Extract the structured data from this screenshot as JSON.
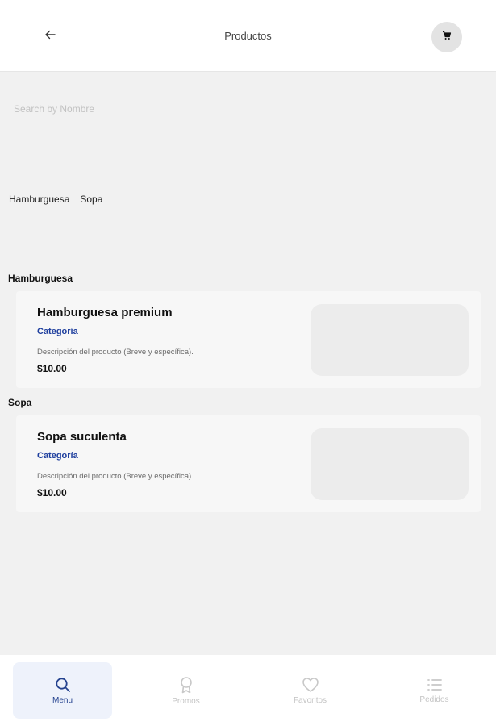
{
  "header": {
    "title": "Productos",
    "back_icon": "arrow-left-icon",
    "cart_icon": "cart-icon"
  },
  "search": {
    "placeholder": "Search by Nombre",
    "value": ""
  },
  "category_chips": [
    "Hamburguesa",
    "Sopa"
  ],
  "sections": [
    {
      "title": "Hamburguesa",
      "product": {
        "name": "Hamburguesa premium",
        "category": "Categoría",
        "description": "Descripción del producto (Breve y específica).",
        "price": "$10.00"
      }
    },
    {
      "title": "Sopa",
      "product": {
        "name": "Sopa suculenta",
        "category": "Categoría",
        "description": "Descripción del producto (Breve y específica).",
        "price": "$10.00"
      }
    }
  ],
  "bottom_nav": [
    {
      "label": "Menu",
      "icon": "search-icon",
      "active": true
    },
    {
      "label": "Promos",
      "icon": "award-icon",
      "active": false
    },
    {
      "label": "Favoritos",
      "icon": "heart-icon",
      "active": false
    },
    {
      "label": "Pedidos",
      "icon": "list-icon",
      "active": false
    }
  ],
  "colors": {
    "accent": "#1f3f9e",
    "nav_active_bg": "#eef2fb",
    "background": "#f1f1f1"
  }
}
